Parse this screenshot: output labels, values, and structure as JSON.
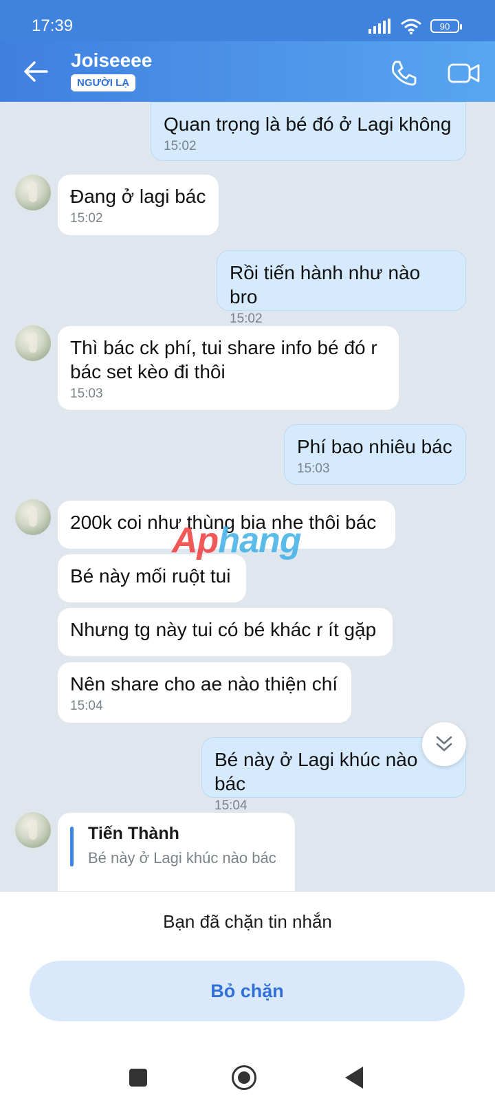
{
  "status_bar": {
    "time": "17:39",
    "battery": "90",
    "icons": [
      "signal-icon",
      "wifi-icon",
      "battery-icon"
    ]
  },
  "header": {
    "contact_name": "Joiseeee",
    "badge": "NGƯỜI LẠ",
    "icons": [
      "back-arrow-icon",
      "phone-icon",
      "video-camera-icon"
    ]
  },
  "messages": [
    {
      "direction": "out",
      "text": "Quan trọng là bé đó ở Lagi không",
      "time": "15:02"
    },
    {
      "direction": "in",
      "text": "Đang ở lagi bác",
      "time": "15:02"
    },
    {
      "direction": "out",
      "text": "Rồi tiến hành như nào bro",
      "time": "15:02"
    },
    {
      "direction": "in",
      "text": "Thì bác ck phí, tui share info bé đó r bác set kèo đi thôi",
      "time": "15:03"
    },
    {
      "direction": "out",
      "text": "Phí bao nhiêu bác",
      "time": "15:03"
    },
    {
      "direction": "in",
      "text": "200k coi như thùng bia nhe thôi bác",
      "time": ""
    },
    {
      "direction": "in",
      "text": "Bé này mối ruột tui",
      "time": ""
    },
    {
      "direction": "in",
      "text": "Nhưng tg này tui có bé khác r ít gặp",
      "time": ""
    },
    {
      "direction": "in",
      "text": "Nên share cho ae nào thiện chí",
      "time": "15:04"
    },
    {
      "direction": "out",
      "text": "Bé này ở Lagi khúc nào bác",
      "time": "15:04"
    }
  ],
  "reply_preview": {
    "name": "Tiến Thành",
    "quoted": "Bé này ở Lagi khúc nào bác"
  },
  "watermark": {
    "part1": "Ap",
    "part2": "hang"
  },
  "bottom": {
    "blocked_text": "Bạn đã chặn tin nhắn",
    "unblock_label": "Bỏ chặn"
  },
  "colors": {
    "accent": "#3f83de",
    "outgoing_bubble": "#d5eafd",
    "incoming_bubble": "#ffffff",
    "chat_background": "#dfe6ee"
  }
}
